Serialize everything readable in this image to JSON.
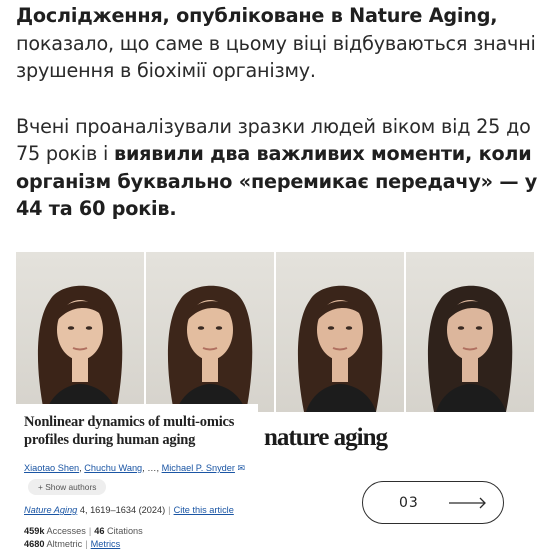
{
  "paragraph1": {
    "bold": "Дослідження, опубліковане в Nature Aging,",
    "rest": " показало, що саме в цьому віці відбуваються значні зрушення в біохімії організму."
  },
  "paragraph2": {
    "plain": "Вчені проаналізували зразки людей віком від 25 до 75 років і ",
    "bold": "виявили два важливих моменти, коли організм буквально «перемикає передачу» — у 44 та 60 років."
  },
  "photos": [
    {
      "hair": "#3b2418",
      "skin": "#e6c2a6"
    },
    {
      "hair": "#3d261a",
      "skin": "#e3bd9f"
    },
    {
      "hair": "#3a251a",
      "skin": "#dfb79b"
    },
    {
      "hair": "#2f221b",
      "skin": "#dcb69c"
    }
  ],
  "paper": {
    "title": "Nonlinear dynamics of multi-omics profiles during human aging",
    "author1": "Xiaotao Shen",
    "author2": "Chuchu Wang",
    "ellipsis": "…",
    "author3": "Michael P. Snyder",
    "show_authors": "+ Show authors",
    "journal": "Nature Aging",
    "volume_pages": " 4, 1619–1634 (2024)",
    "cite": "Cite this article",
    "accesses_value": "459k",
    "accesses_label": " Accesses",
    "citations_value": "46",
    "citations_label": " Citations",
    "altmetric_value": "4680",
    "altmetric_label": " Altmetric",
    "metrics_link": "Metrics"
  },
  "logo": "nature aging",
  "pager": {
    "number": "03"
  }
}
